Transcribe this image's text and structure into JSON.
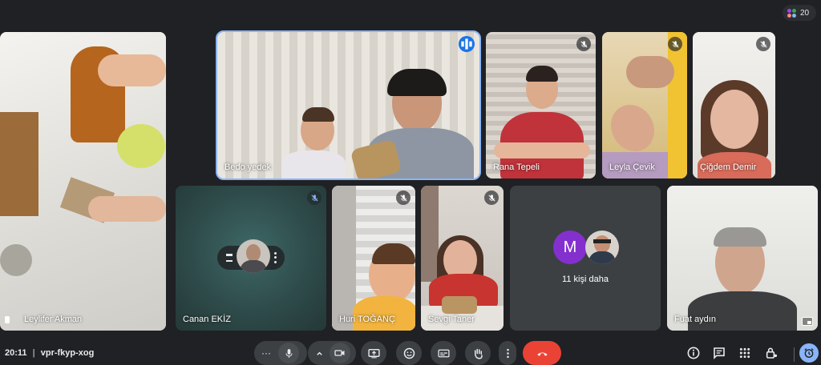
{
  "participant_count": "20",
  "participants": [
    {
      "name": "Leylifer Akman"
    },
    {
      "name": "Bedo yedek"
    },
    {
      "name": "Rana Tepeli"
    },
    {
      "name": "Leyla Çevik"
    },
    {
      "name": "Çiğdem Demir"
    },
    {
      "name": "Canan EKİZ"
    },
    {
      "name": "Huri TOĞANÇ"
    },
    {
      "name": "Sevgi Taner"
    },
    {
      "name": "Fuat aydın"
    }
  ],
  "others_tile": {
    "avatar_letter": "M",
    "label": "11 kişi daha"
  },
  "bar": {
    "time": "20:11",
    "meeting_code": "vpr-fkyp-xog"
  },
  "colors": {
    "background": "#202124",
    "accent": "#8ab4f8",
    "end_call": "#ea4335",
    "avatar_m": "#8430ce"
  }
}
